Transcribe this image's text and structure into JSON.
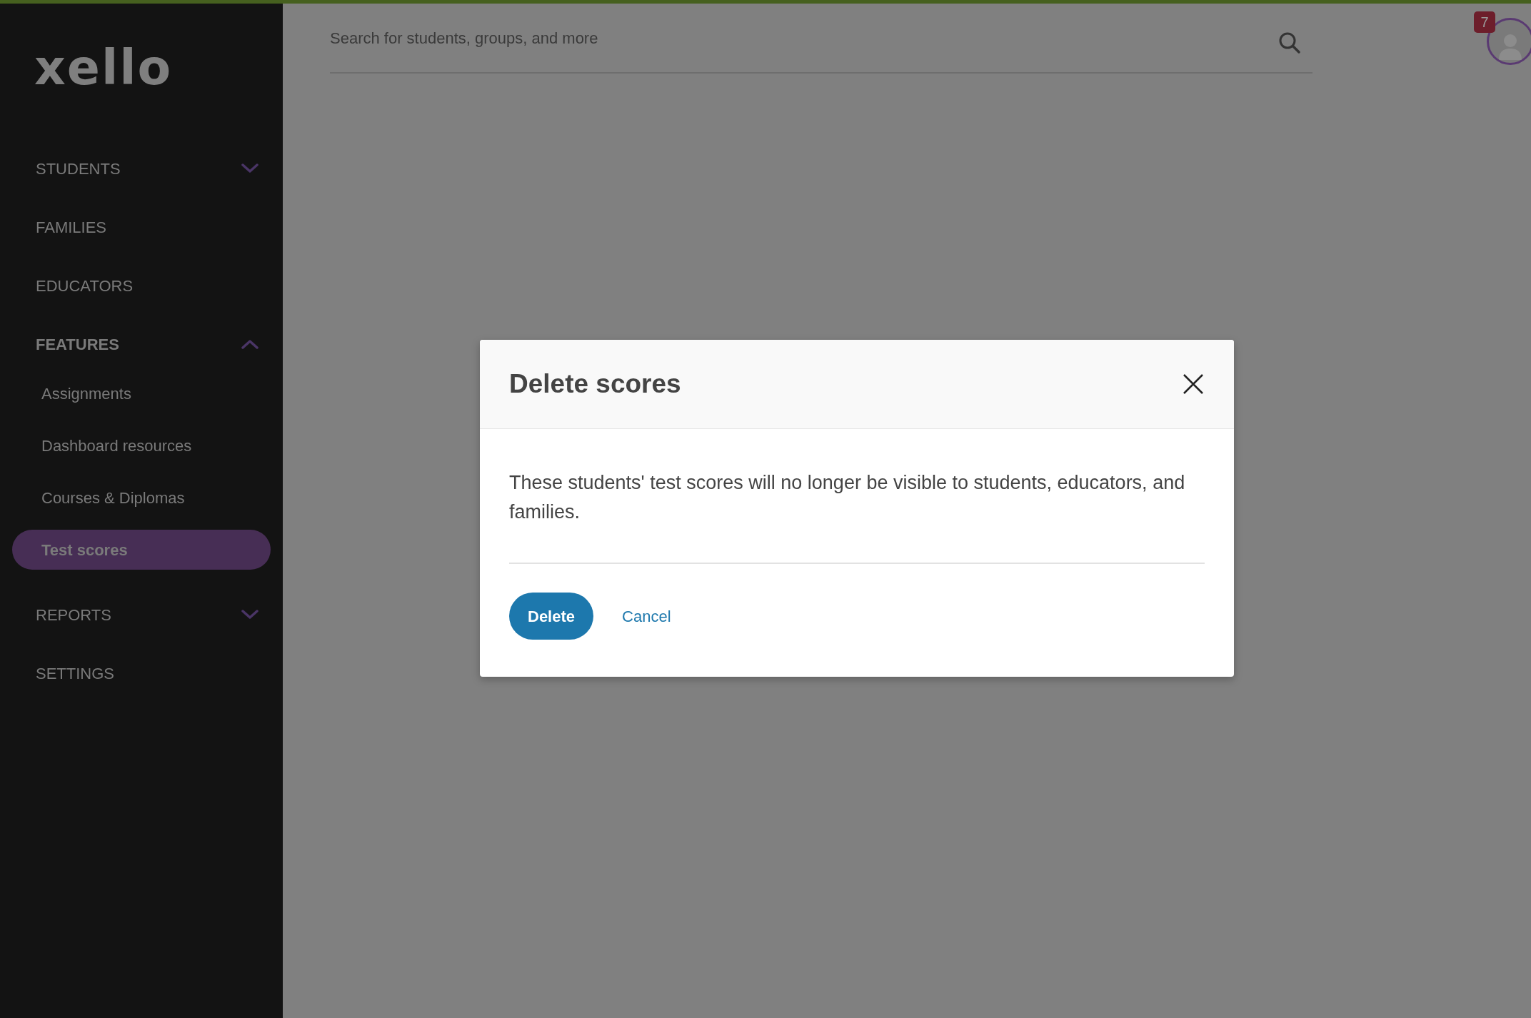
{
  "logo": {
    "text": "xello"
  },
  "search": {
    "placeholder": "Search for students, groups, and more"
  },
  "notifications": {
    "count": "7"
  },
  "sidebar": {
    "items": [
      {
        "label": "STUDENTS",
        "kind": "group",
        "expanded": false
      },
      {
        "label": "FAMILIES",
        "kind": "link"
      },
      {
        "label": "EDUCATORS",
        "kind": "link"
      },
      {
        "label": "FEATURES",
        "kind": "group",
        "expanded": true,
        "children": [
          {
            "label": "Assignments",
            "selected": false
          },
          {
            "label": "Dashboard resources",
            "selected": false
          },
          {
            "label": "Courses & Diplomas",
            "selected": false
          },
          {
            "label": "Test scores",
            "selected": true
          }
        ]
      },
      {
        "label": "REPORTS",
        "kind": "group",
        "expanded": false
      },
      {
        "label": "SETTINGS",
        "kind": "link"
      }
    ]
  },
  "dialog": {
    "title": "Delete scores",
    "message": "These students' test scores will no longer be visible to students, educators, and families.",
    "buttons": [
      {
        "label": "Delete",
        "kind": "primary"
      },
      {
        "label": "Cancel",
        "kind": "link"
      }
    ]
  }
}
